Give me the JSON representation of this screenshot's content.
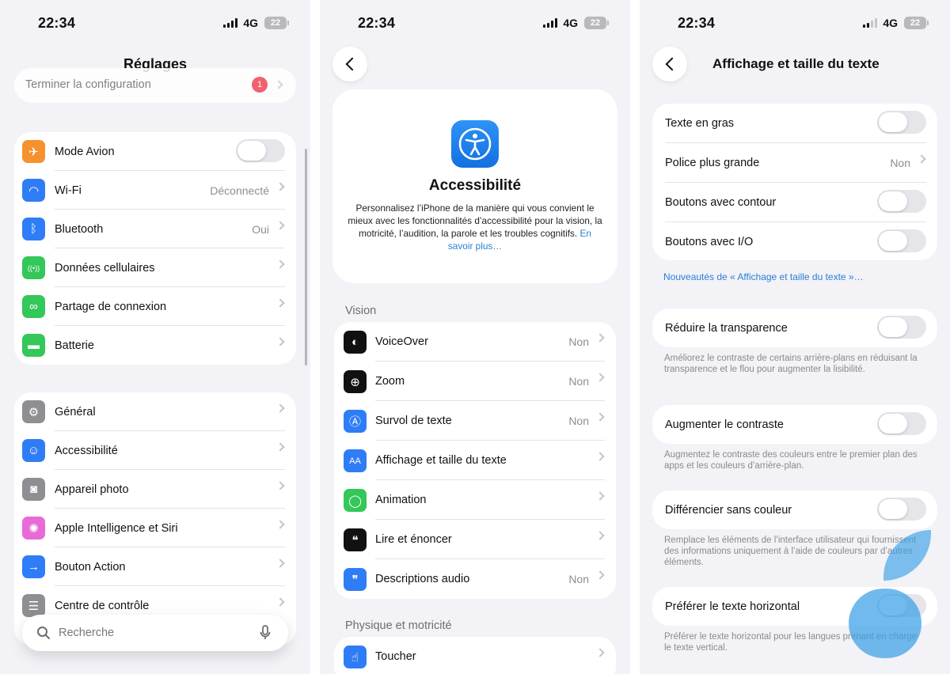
{
  "status_bar": {
    "time": "22:34",
    "network": "4G",
    "battery": "22"
  },
  "panel1": {
    "title": "Réglages",
    "setup_banner": {
      "label": "Terminer la configuration",
      "badge": "1"
    },
    "group1": [
      {
        "label": "Mode Avion",
        "type": "toggle",
        "icon": "airplane-icon",
        "color": "#f5922f"
      },
      {
        "label": "Wi-Fi",
        "value": "Déconnecté",
        "icon": "wifi-icon",
        "color": "#2f7df6"
      },
      {
        "label": "Bluetooth",
        "value": "Oui",
        "icon": "bluetooth-icon",
        "color": "#2f7df6"
      },
      {
        "label": "Données cellulaires",
        "icon": "cellular-icon",
        "color": "#34c759"
      },
      {
        "label": "Partage de connexion",
        "icon": "hotspot-icon",
        "color": "#34c759"
      },
      {
        "label": "Batterie",
        "icon": "battery-icon",
        "color": "#34c759"
      }
    ],
    "group2": [
      {
        "label": "Général",
        "icon": "gear-icon",
        "color": "#8e8e93"
      },
      {
        "label": "Accessibilité",
        "icon": "accessibility-icon",
        "color": "#2f7df6"
      },
      {
        "label": "Appareil photo",
        "icon": "camera-icon",
        "color": "#8e8e93"
      },
      {
        "label": "Apple Intelligence et Siri",
        "icon": "siri-icon",
        "color": "#e86ad6"
      },
      {
        "label": "Bouton Action",
        "icon": "action-button-icon",
        "color": "#2f7df6"
      },
      {
        "label": "Centre de contrôle",
        "icon": "control-center-icon",
        "color": "#8e8e93"
      }
    ],
    "search": {
      "placeholder": "Recherche"
    }
  },
  "panel2": {
    "hero": {
      "title": "Accessibilité",
      "description": "Personnalisez l’iPhone de la manière qui vous convient le mieux avec les fonctionnalités d’accessibilité pour la vision, la motricité, l’audition, la parole et les troubles cognitifs.",
      "link": "En savoir plus…"
    },
    "section_vision": "Vision",
    "vision_items": [
      {
        "label": "VoiceOver",
        "value": "Non",
        "icon": "voiceover-icon",
        "color": "#111111"
      },
      {
        "label": "Zoom",
        "value": "Non",
        "icon": "zoom-icon",
        "color": "#111111"
      },
      {
        "label": "Survol de texte",
        "value": "Non",
        "icon": "hover-text-icon",
        "color": "#2f7df6"
      },
      {
        "label": "Affichage et taille du texte",
        "icon": "text-size-icon",
        "color": "#2f7df6"
      },
      {
        "label": "Animation",
        "icon": "animation-icon",
        "color": "#34c759"
      },
      {
        "label": "Lire et énoncer",
        "icon": "speak-icon",
        "color": "#111111"
      },
      {
        "label": "Descriptions audio",
        "value": "Non",
        "icon": "audio-description-icon",
        "color": "#2f7df6"
      }
    ],
    "section_physique": "Physique et motricité",
    "physique_items": [
      {
        "label": "Toucher",
        "icon": "touch-icon",
        "color": "#2f7df6"
      }
    ]
  },
  "panel3": {
    "title": "Affichage et taille du texte",
    "group1": [
      {
        "label": "Texte en gras",
        "type": "toggle"
      },
      {
        "label": "Police plus grande",
        "value": "Non",
        "type": "chevron"
      },
      {
        "label": "Boutons avec contour",
        "type": "toggle"
      },
      {
        "label": "Boutons avec I/O",
        "type": "toggle"
      }
    ],
    "whats_new_link": "Nouveautés de « Affichage et taille du texte »…",
    "reduce_transparency": {
      "label": "Réduire la transparence",
      "footer": "Améliorez le contraste de certains arrière-plans en réduisant la transparence et le flou pour augmenter la lisibilité."
    },
    "increase_contrast": {
      "label": "Augmenter le contraste",
      "footer": "Augmentez le contraste des couleurs entre le premier plan des apps et les couleurs d’arrière-plan."
    },
    "differentiate": {
      "label": "Différencier sans couleur",
      "footer": "Remplace les éléments de l’interface utilisateur qui fournissent des informations uniquement à l’aide de couleurs par d’autres éléments."
    },
    "horizontal_text": {
      "label": "Préférer le texte horizontal",
      "footer": "Préférer le texte horizontal pour les langues prenant en charge le texte vertical."
    }
  }
}
